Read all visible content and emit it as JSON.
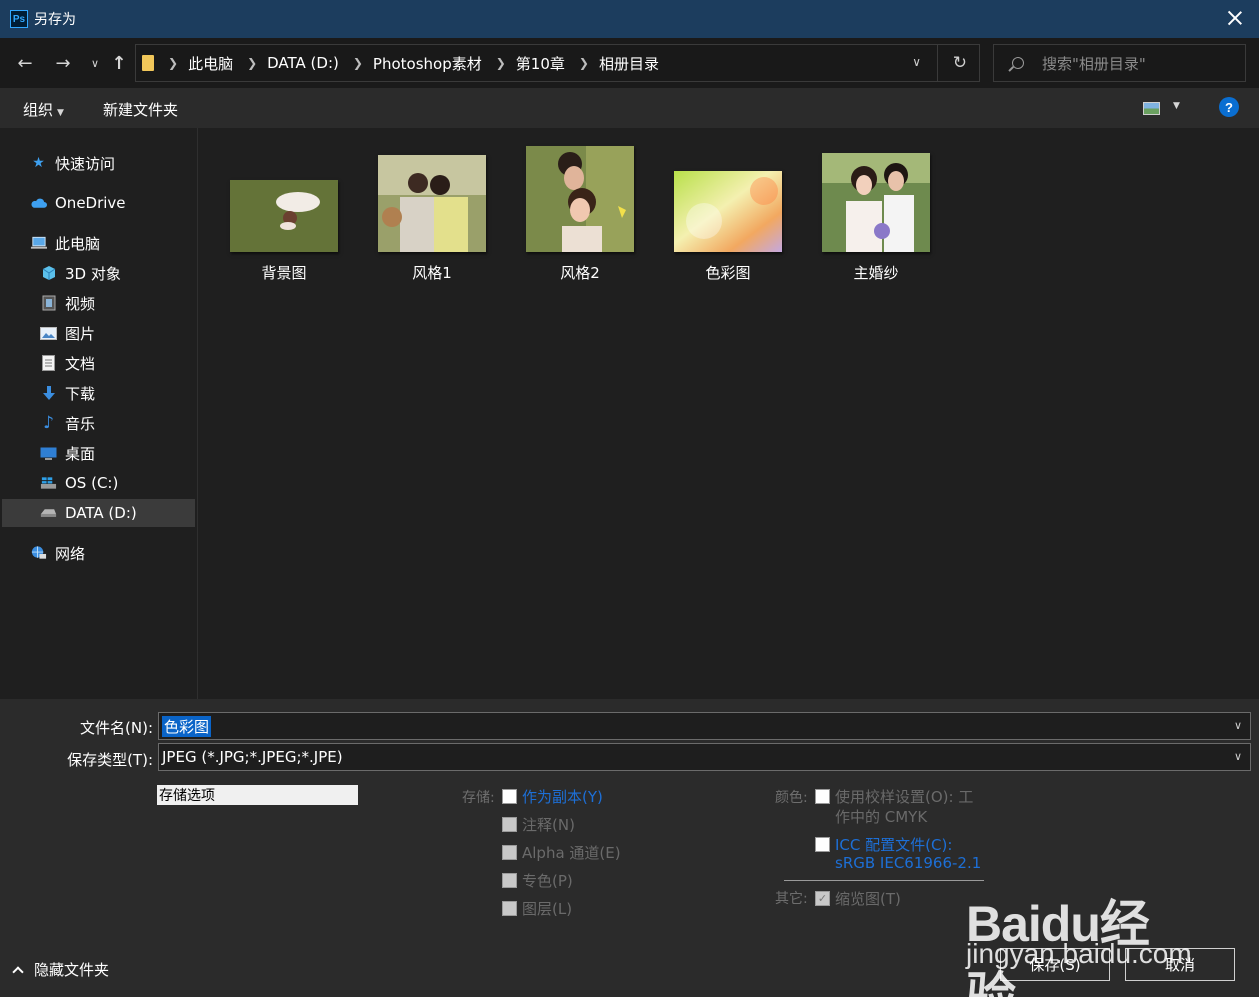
{
  "window": {
    "title": "另存为",
    "app_icon": "Ps"
  },
  "nav": {
    "breadcrumbs": [
      "此电脑",
      "DATA (D:)",
      "Photoshop素材",
      "第10章",
      "相册目录"
    ],
    "search_placeholder": "搜索\"相册目录\""
  },
  "toolbar": {
    "organize": "组织",
    "new_folder": "新建文件夹",
    "help": "?"
  },
  "sidebar": {
    "items": [
      {
        "label": "快速访问",
        "icon": "star-icon"
      },
      {
        "label": "OneDrive",
        "icon": "cloud-icon"
      },
      {
        "label": "此电脑",
        "icon": "computer-icon"
      },
      {
        "label": "3D 对象",
        "icon": "cube-icon"
      },
      {
        "label": "视频",
        "icon": "film-icon"
      },
      {
        "label": "图片",
        "icon": "picture-icon"
      },
      {
        "label": "文档",
        "icon": "document-icon"
      },
      {
        "label": "下载",
        "icon": "download-arrow-icon"
      },
      {
        "label": "音乐",
        "icon": "music-note-icon"
      },
      {
        "label": "桌面",
        "icon": "desktop-icon"
      },
      {
        "label": "OS (C:)",
        "icon": "windows-drive-icon"
      },
      {
        "label": "DATA (D:)",
        "icon": "drive-icon"
      },
      {
        "label": "网络",
        "icon": "network-icon"
      }
    ],
    "selected_index": 11
  },
  "files": [
    {
      "name": "背景图"
    },
    {
      "name": "风格1"
    },
    {
      "name": "风格2"
    },
    {
      "name": "色彩图"
    },
    {
      "name": "主婚纱"
    }
  ],
  "form": {
    "filename_label": "文件名(N):",
    "filename_value": "色彩图",
    "filetype_label": "保存类型(T):",
    "filetype_value": "JPEG (*.JPG;*.JPEG;*.JPE)",
    "options_label": "存储选项",
    "storage_label": "存储:",
    "storage_options": [
      "作为副本(Y)",
      "注释(N)",
      "Alpha 通道(E)",
      "专色(P)",
      "图层(L)"
    ],
    "color_label": "颜色:",
    "proof_line1": "使用校样设置(O):  工",
    "proof_line2": "作中的 CMYK",
    "icc_line1": "ICC 配置文件(C):",
    "icc_line2": "sRGB IEC61966-2.1",
    "other_label": "其它:",
    "thumbnail": "缩览图(T)",
    "thumbnail_checked": true
  },
  "footer": {
    "hide_folders": "隐藏文件夹",
    "save_button": "保存(S)",
    "cancel_button": "取消"
  },
  "watermark": {
    "main": "Baidu经验",
    "url": "jingyan.baidu.com"
  },
  "colors": {
    "title_bar": "#1c3d5e",
    "accent_blue": "#0a64c8",
    "link_blue": "#1d6fd6"
  }
}
